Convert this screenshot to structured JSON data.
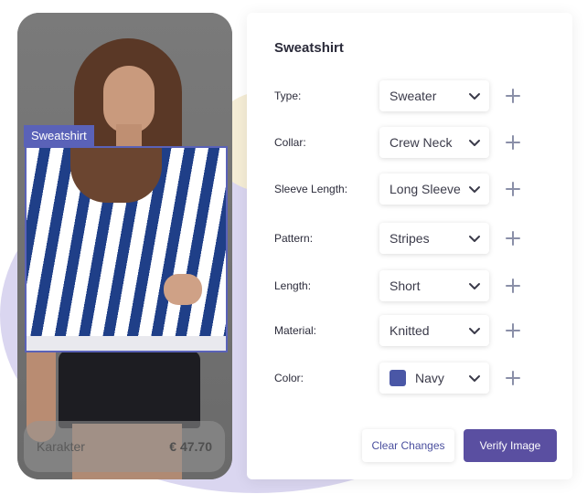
{
  "product": {
    "detection_label": "Sweatshirt",
    "name": "Karakter",
    "price": "€ 47.70"
  },
  "editor": {
    "title": "Sweatshirt",
    "attributes": [
      {
        "label": "Type:",
        "value": "Sweater"
      },
      {
        "label": "Collar:",
        "value": "Crew Neck"
      },
      {
        "label": "Sleeve Length:",
        "value": "Long Sleeve"
      },
      {
        "label": "Pattern:",
        "value": "Stripes"
      },
      {
        "label": "Length:",
        "value": "Short"
      },
      {
        "label": "Material:",
        "value": "Knitted"
      },
      {
        "label": "Color:",
        "value": "Navy",
        "swatch": "#4a57a6"
      }
    ],
    "clear_label": "Clear Changes",
    "verify_label": "Verify Image"
  },
  "colors": {
    "accent": "#5a4fa1",
    "detection_box": "#5a62b8"
  },
  "icons": {
    "dropdown": "chevron-down-icon",
    "add": "plus-icon"
  }
}
